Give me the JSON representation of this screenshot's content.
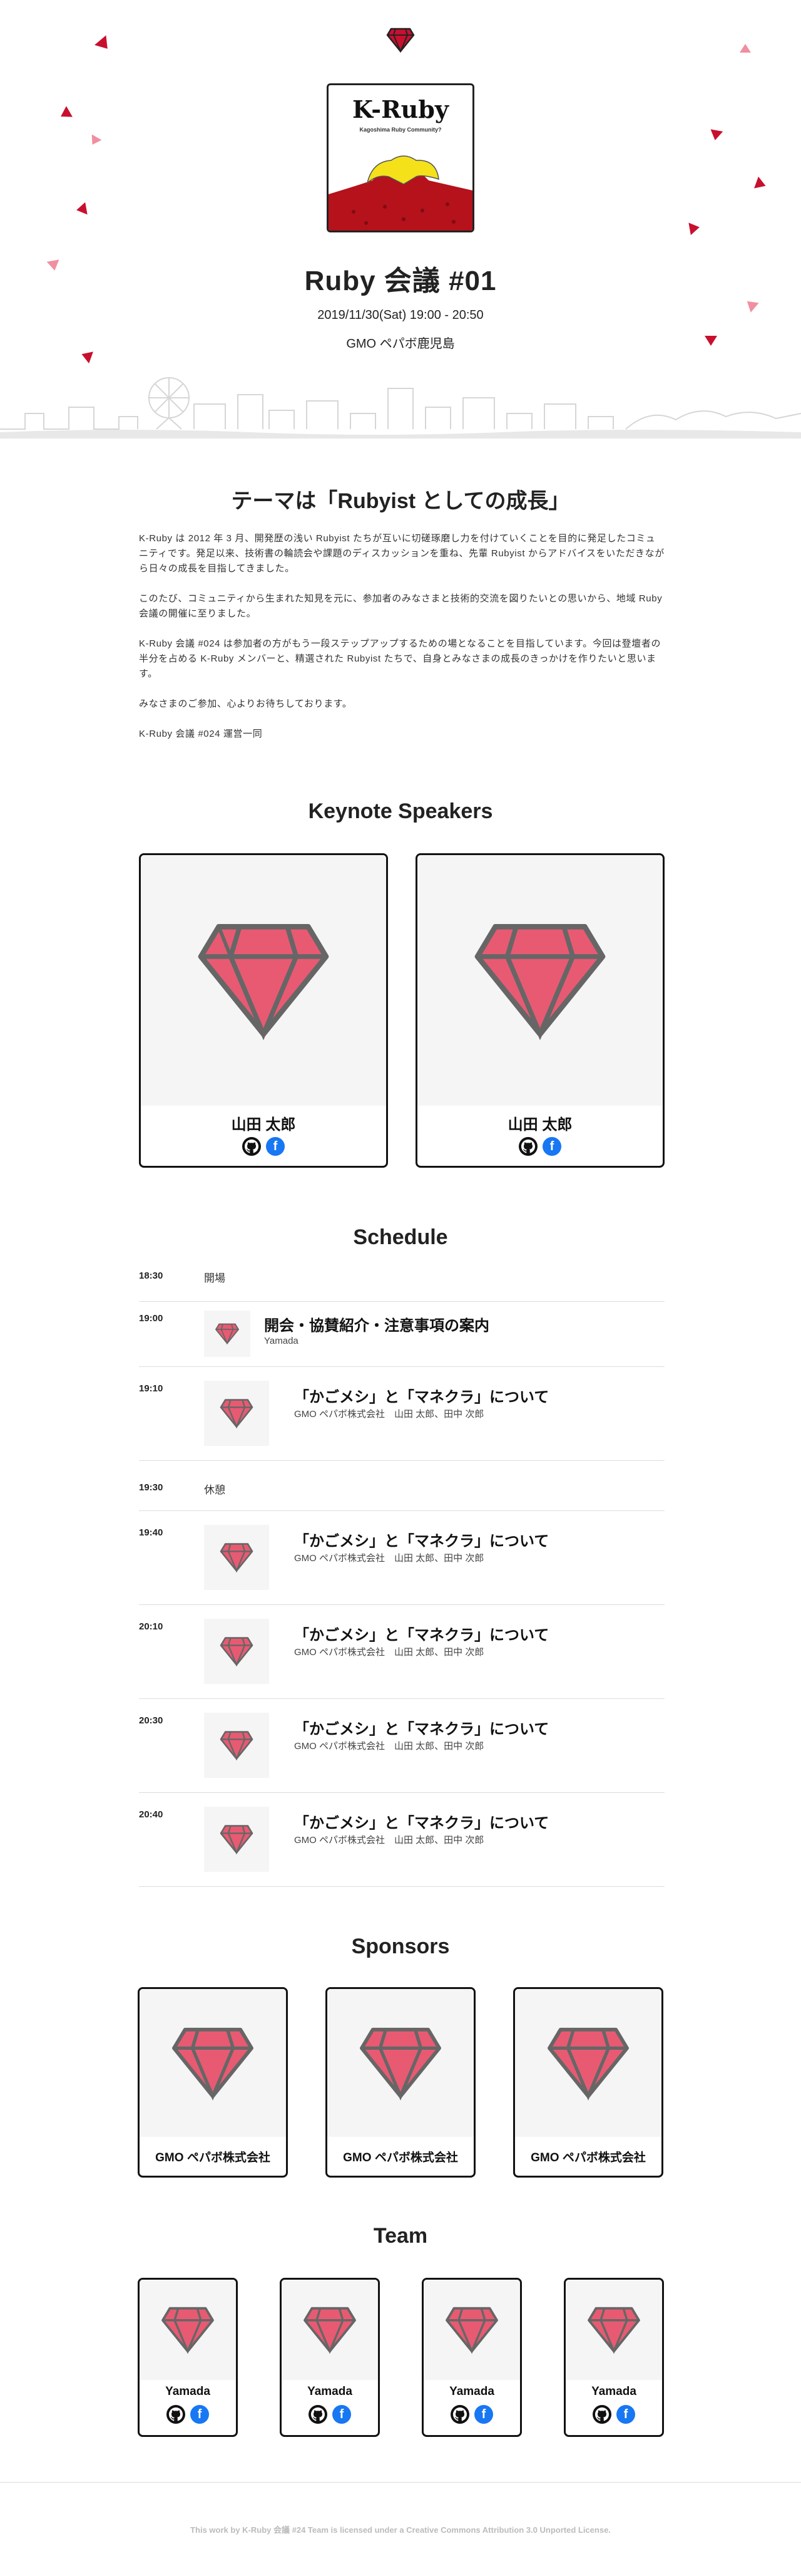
{
  "hero": {
    "logo_title": "K-Ruby",
    "logo_subtitle": "Kagoshima Ruby Community?",
    "title": "Ruby 会議 #01",
    "date": "2019/11/30(Sat) 19:00 - 20:50",
    "venue": "GMO ペパボ鹿児島",
    "accent_color": "#c8102e",
    "pink_color": "#f08fa0"
  },
  "theme": {
    "title": "テーマは「Rubyist としての成長」",
    "paragraphs": [
      "K-Ruby は 2012 年 3 月、開発歴の浅い Rubyist たちが互いに切磋琢磨し力を付けていくことを目的に発足したコミュニティです。発足以来、技術書の輪読会や課題のディスカッションを重ね、先輩 Rubyist からアドバイスをいただきながら日々の成長を目指してきました。",
      "このたび、コミュニティから生まれた知見を元に、参加者のみなさまと技術的交流を図りたいとの思いから、地域 Ruby 会議の開催に至りました。",
      "K-Ruby 会議 #024 は参加者の方がもう一段ステップアップするための場となることを目指しています。今回は登壇者の半分を占める K-Ruby メンバーと、精選された Rubyist たちで、自身とみなさまの成長のきっかけを作りたいと思います。",
      "みなさまのご参加、心よりお待ちしております。",
      "K-Ruby 会議 #024 運営一同"
    ]
  },
  "speakers": {
    "title": "Keynote Speakers",
    "items": [
      {
        "name": "山田 太郎"
      },
      {
        "name": "山田 太郎"
      }
    ]
  },
  "schedule": {
    "title": "Schedule",
    "items": [
      {
        "time": "18:30",
        "label": "開場"
      },
      {
        "time": "19:00",
        "title": "開会・協賛紹介・注意事項の案内",
        "sub": "Yamada"
      },
      {
        "time": "19:10",
        "title": "「かごメシ」と「マネクラ」について",
        "sub": "GMO ペパボ株式会社　山田 太郎、田中 次郎"
      },
      {
        "time": "19:30",
        "label": "休憩"
      },
      {
        "time": "19:40",
        "title": "「かごメシ」と「マネクラ」について",
        "sub": "GMO ペパボ株式会社　山田 太郎、田中 次郎"
      },
      {
        "time": "20:10",
        "title": "「かごメシ」と「マネクラ」について",
        "sub": "GMO ペパボ株式会社　山田 太郎、田中 次郎"
      },
      {
        "time": "20:30",
        "title": "「かごメシ」と「マネクラ」について",
        "sub": "GMO ペパボ株式会社　山田 太郎、田中 次郎"
      },
      {
        "time": "20:40",
        "title": "「かごメシ」と「マネクラ」について",
        "sub": "GMO ペパボ株式会社　山田 太郎、田中 次郎"
      }
    ]
  },
  "sponsors": {
    "title": "Sponsors",
    "items": [
      {
        "name": "GMO ペパボ株式会社"
      },
      {
        "name": "GMO ペパボ株式会社"
      },
      {
        "name": "GMO ペパボ株式会社"
      }
    ]
  },
  "team": {
    "title": "Team",
    "items": [
      {
        "name": "Yamada"
      },
      {
        "name": "Yamada"
      },
      {
        "name": "Yamada"
      },
      {
        "name": "Yamada"
      }
    ]
  },
  "footer": {
    "text": "This work by K-Ruby 会議 #24 Team is licensed under a Creative Commons Attribution 3.0 Unported License."
  },
  "icons": {
    "gem": "ruby-gem-icon",
    "github": "github-icon",
    "facebook": "facebook-icon"
  }
}
